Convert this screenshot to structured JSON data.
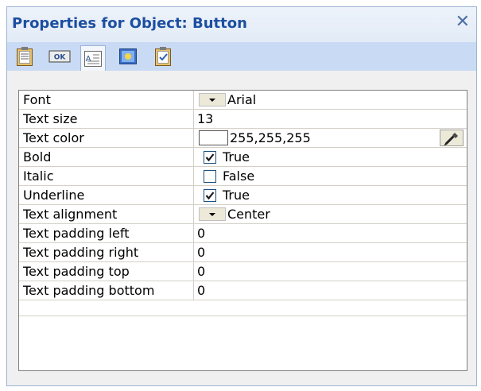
{
  "window": {
    "title": "Properties for Object: Button",
    "close_glyph": "✕"
  },
  "toolbar": {
    "tabs": [
      {
        "icon": "clipboard-icon",
        "label": ""
      },
      {
        "icon": "ok-button-icon",
        "label": "OK"
      },
      {
        "icon": "text-format-icon",
        "label": "A"
      },
      {
        "icon": "image-icon",
        "label": ""
      },
      {
        "icon": "clipboard-check-icon",
        "label": ""
      }
    ],
    "active_tab": 2
  },
  "properties": [
    {
      "name": "Font",
      "type": "dropdown",
      "value": "Arial"
    },
    {
      "name": "Text size",
      "type": "text",
      "value": "13"
    },
    {
      "name": "Text color",
      "type": "color",
      "value": "255,255,255",
      "color": "#ffffff"
    },
    {
      "name": "Bold",
      "type": "checkbox",
      "checked": true,
      "value": "True"
    },
    {
      "name": "Italic",
      "type": "checkbox",
      "checked": false,
      "value": "False"
    },
    {
      "name": "Underline",
      "type": "checkbox",
      "checked": true,
      "value": "True"
    },
    {
      "name": "Text alignment",
      "type": "dropdown",
      "value": "Center"
    },
    {
      "name": "Text padding left",
      "type": "text",
      "value": "0"
    },
    {
      "name": "Text padding right",
      "type": "text",
      "value": "0"
    },
    {
      "name": "Text padding top",
      "type": "text",
      "value": "0"
    },
    {
      "name": "Text padding bottom",
      "type": "text",
      "value": "0"
    }
  ],
  "colors": {
    "title_text": "#1c4fa0",
    "toolbar_bg": "#c9daf4",
    "check_mark": "#1a1a1a",
    "grid_line": "#d4d0c8"
  }
}
